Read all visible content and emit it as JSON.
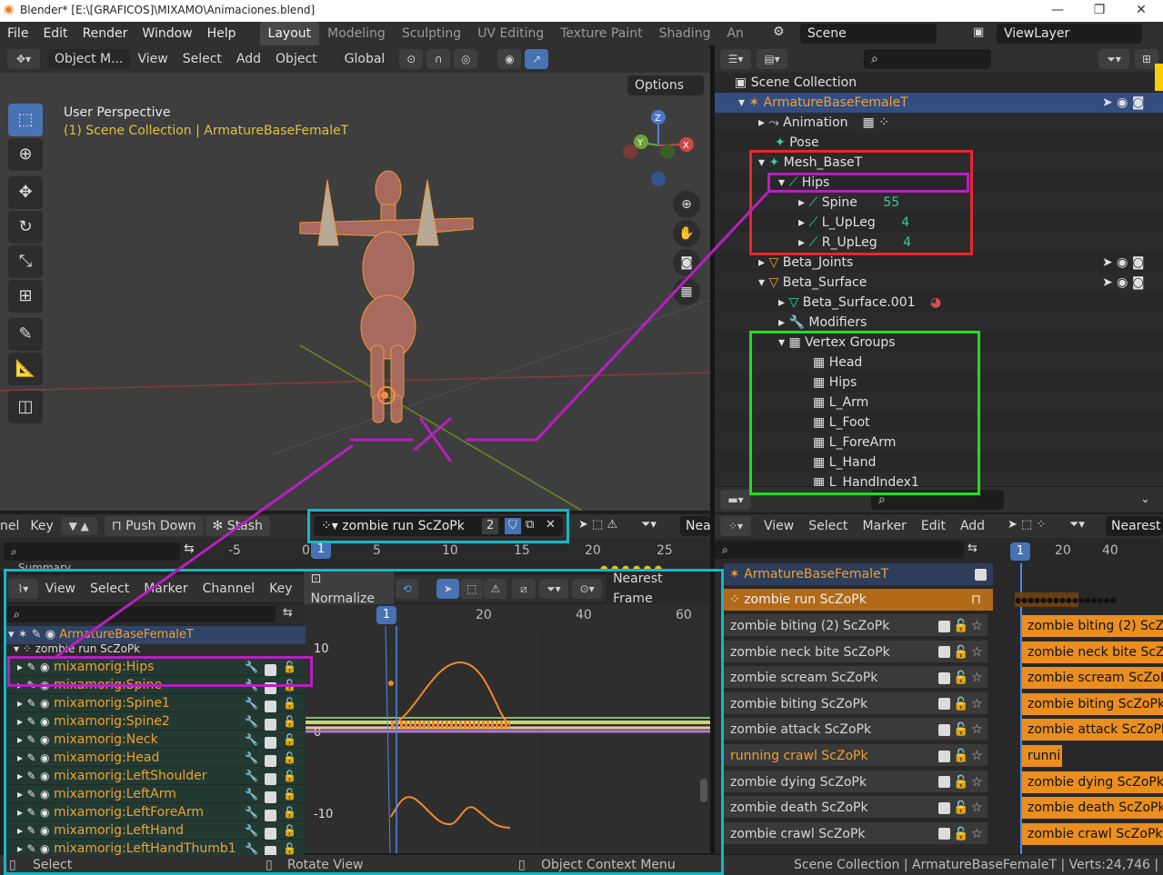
{
  "titlebar": {
    "title": "Blender* [E:\\[GRAFICOS]\\MIXAMO\\Animaciones.blend]"
  },
  "menu": [
    "File",
    "Edit",
    "Render",
    "Window",
    "Help"
  ],
  "workspaces": [
    "Layout",
    "Modeling",
    "Sculpting",
    "UV Editing",
    "Texture Paint",
    "Shading",
    "An"
  ],
  "scene": "Scene",
  "view_layer": "ViewLayer",
  "viewport": {
    "mode": "Object M...",
    "menus": [
      "View",
      "Select",
      "Add",
      "Object"
    ],
    "transform": "Global",
    "options": "Options",
    "overlay_title": "User Perspective",
    "overlay_sub": "(1) Scene Collection | ArmatureBaseFemaleT"
  },
  "outliner": {
    "rows": [
      {
        "label": "Scene Collection"
      },
      {
        "label": "ArmatureBaseFemaleT"
      },
      {
        "label": "Animation"
      },
      {
        "label": "Pose"
      },
      {
        "label": "Mesh_BaseT"
      },
      {
        "label": "Hips"
      },
      {
        "label": "Spine",
        "badge": "55"
      },
      {
        "label": "L_UpLeg",
        "badge": "4"
      },
      {
        "label": "R_UpLeg",
        "badge": "4"
      },
      {
        "label": "Beta_Joints"
      },
      {
        "label": "Beta_Surface"
      },
      {
        "label": "Beta_Surface.001"
      },
      {
        "label": "Modifiers"
      },
      {
        "label": "Vertex Groups"
      },
      {
        "label": "Head"
      },
      {
        "label": "Hips"
      },
      {
        "label": "L_Arm"
      },
      {
        "label": "L_Foot"
      },
      {
        "label": "L_ForeArm"
      },
      {
        "label": "L_Hand"
      },
      {
        "label": "L_HandIndex1"
      }
    ]
  },
  "dopesheet": {
    "menus": [
      "nel",
      "Key"
    ],
    "push_down": "Push Down",
    "stash": "Stash",
    "action": "zombie run ScZoPk",
    "users": "2",
    "near": "Nea",
    "ticks": [
      "-5",
      "0",
      "5",
      "10",
      "15",
      "20",
      "25"
    ],
    "current_frame": "1",
    "summary": "Summary"
  },
  "graph": {
    "menus": [
      "View",
      "Select",
      "Marker",
      "Channel",
      "Key"
    ],
    "normalize": "Normalize",
    "nearest_frame": "Nearest Frame",
    "ticks": [
      "20",
      "40",
      "60"
    ],
    "current_frame": "1",
    "y_labels": [
      "10",
      "0",
      "-10"
    ],
    "object": "ArmatureBaseFemaleT",
    "action_row": "zombie run ScZoPk",
    "channels": [
      "mixamorig:Hips",
      "mixamorig:Spine",
      "mixamorig:Spine1",
      "mixamorig:Spine2",
      "mixamorig:Neck",
      "mixamorig:Head",
      "mixamorig:LeftShoulder",
      "mixamorig:LeftArm",
      "mixamorig:LeftForeArm",
      "mixamorig:LeftHand",
      "mixamorig:LeftHandThumb1"
    ]
  },
  "nla": {
    "menus": [
      "View",
      "Select",
      "Marker",
      "Edit",
      "Add"
    ],
    "nearest": "Nearest",
    "ticks": [
      "1",
      "20",
      "40"
    ],
    "object": "ArmatureBaseFemaleT",
    "active_action": "zombie run ScZoPk",
    "tracks": [
      {
        "name": "zombie biting (2) ScZoPk",
        "strip": "zombie biting (2) ScZo"
      },
      {
        "name": "zombie neck bite ScZoPk",
        "strip": "zombie neck bite ScZ"
      },
      {
        "name": "zombie scream ScZoPk",
        "strip": "zombie scream ScZoP"
      },
      {
        "name": "zombie biting ScZoPk",
        "strip": "zombie biting ScZoPk"
      },
      {
        "name": "zombie attack ScZoPk",
        "strip": "zombie attack ScZoPk"
      },
      {
        "name": "running crawl ScZoPk",
        "strip": "runni"
      },
      {
        "name": "zombie dying ScZoPk",
        "strip": "zombie dying ScZoPk"
      },
      {
        "name": "zombie death ScZoPk",
        "strip": "zombie death ScZoPk"
      },
      {
        "name": "zombie crawl ScZoPk",
        "strip": "zombie crawl ScZoPk"
      }
    ]
  },
  "status": {
    "select": "Select",
    "rotate": "Rotate View",
    "context": "Object Context Menu",
    "right": "Scene Collection | ArmatureBaseFemaleT | Verts:24,746 | F"
  },
  "colors": {
    "accent": "#4772b3",
    "orange": "#e98e1f",
    "annot_red": "#e8262e",
    "annot_magenta": "#b620c0",
    "annot_green": "#1fdf1f",
    "annot_cyan": "#11b8c7"
  }
}
